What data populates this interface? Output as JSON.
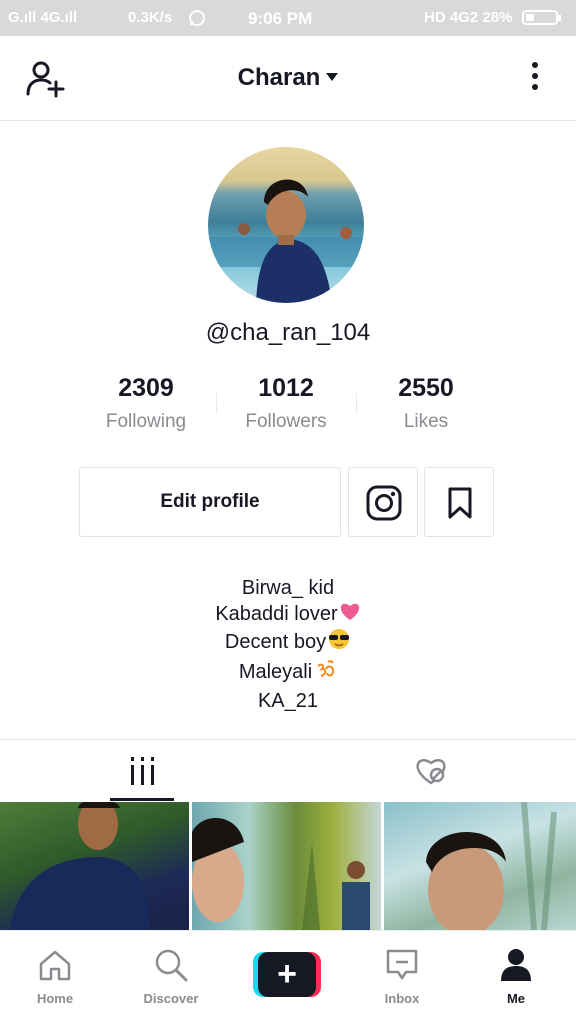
{
  "status_bar": {
    "network": "G.ıll 4G.ıll",
    "speed": "0.3K/s",
    "time": "9:06 PM",
    "right": "HD 4G2 28%",
    "battery_percent": 28
  },
  "header": {
    "username": "Charan"
  },
  "profile": {
    "handle": "@cha_ran_104",
    "stats": [
      {
        "value": "2309",
        "label": "Following"
      },
      {
        "value": "1012",
        "label": "Followers"
      },
      {
        "value": "2550",
        "label": "Likes"
      }
    ],
    "edit_profile_label": "Edit profile",
    "bio": [
      "Birwa_ kid",
      "Kabaddi lover",
      "Decent boy",
      "Maleyali",
      "KA_21"
    ]
  },
  "bottom_nav": {
    "items": [
      {
        "label": "Home",
        "icon": "home-icon"
      },
      {
        "label": "Discover",
        "icon": "search-icon"
      },
      {
        "label": "Inbox",
        "icon": "inbox-icon"
      },
      {
        "label": "Me",
        "icon": "person-icon"
      }
    ]
  },
  "colors": {
    "accent_red": "#fe2c55",
    "accent_cyan": "#20d5ec",
    "text": "#161823",
    "muted": "#8a8b91"
  }
}
